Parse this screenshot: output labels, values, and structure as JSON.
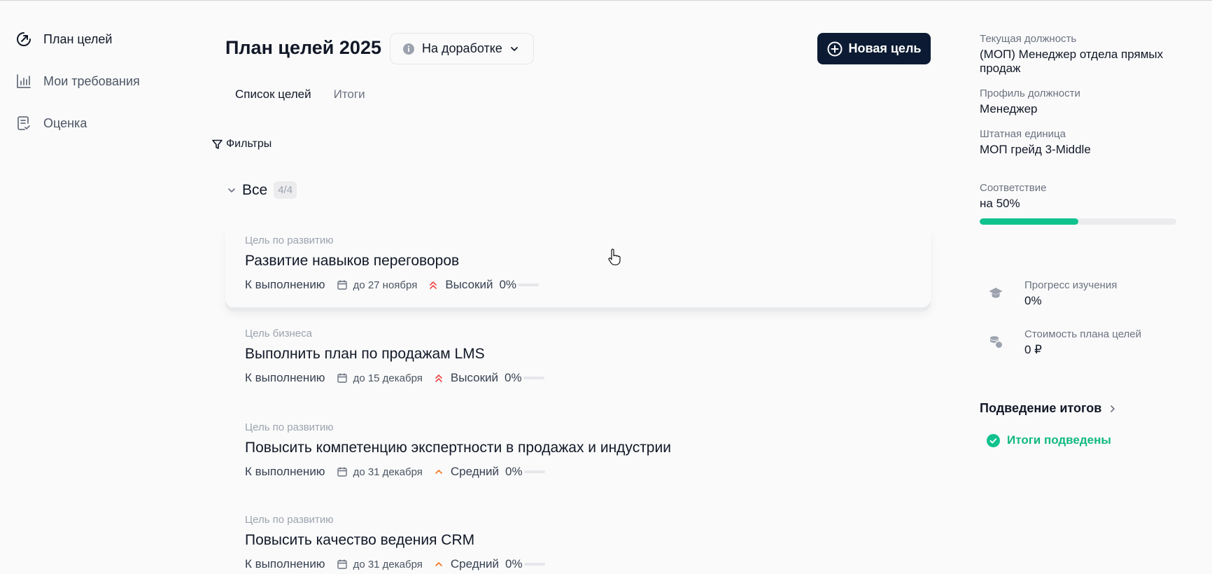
{
  "sidebar": {
    "items": [
      {
        "label": "План целей",
        "icon": "target-arrow-icon",
        "active": true
      },
      {
        "label": "Мои требования",
        "icon": "chart-bars-icon",
        "active": false
      },
      {
        "label": "Оценка",
        "icon": "document-check-icon",
        "active": false
      }
    ]
  },
  "header": {
    "title": "План целей 2025",
    "status_label": "На доработке",
    "new_goal_label": "Новая цель"
  },
  "tabs": [
    {
      "label": "Список целей",
      "active": true
    },
    {
      "label": "Итоги",
      "active": false
    }
  ],
  "filters": {
    "label": "Фильтры"
  },
  "group": {
    "label": "Все",
    "badge": "4/4"
  },
  "goals": [
    {
      "type": "Цель по развитию",
      "title": "Развитие навыков переговоров",
      "status": "К выполнению",
      "deadline": "до 27 ноября",
      "priority": "Высокий",
      "priority_level": "high",
      "progress": "0%",
      "progress_fraction": 0
    },
    {
      "type": "Цель бизнеса",
      "title": "Выполнить план по продажам LMS",
      "status": "К выполнению",
      "deadline": "до 15 декабря",
      "priority": "Высокий",
      "priority_level": "high",
      "progress": "0%",
      "progress_fraction": 0
    },
    {
      "type": "Цель по развитию",
      "title": "Повысить компетенцию экспертности в продажах и индустрии",
      "status": "К выполнению",
      "deadline": "до 31 декабря",
      "priority": "Средний",
      "priority_level": "medium",
      "progress": "0%",
      "progress_fraction": 0
    },
    {
      "type": "Цель по развитию",
      "title": "Повысить качество ведения CRM",
      "status": "К выполнению",
      "deadline": "до 31 декабря",
      "priority": "Средний",
      "priority_level": "medium",
      "progress": "0%",
      "progress_fraction": 0
    }
  ],
  "profile": {
    "position_label": "Текущая должность",
    "position_value": "(МОП) Менеджер отдела прямых продаж",
    "profile_label": "Профиль должности",
    "profile_value": "Менеджер",
    "unit_label": "Штатная единица",
    "unit_value": "МОП грейд 3-Middle",
    "match_label": "Соответствие",
    "match_value": "на 50%",
    "match_fraction": 0.5
  },
  "stats": {
    "learning_label": "Прогресс изучения",
    "learning_value": "0%",
    "cost_label": "Стоимость плана целей",
    "cost_value": "0 ₽"
  },
  "summary": {
    "link_label": "Подведение итогов",
    "status_label": "Итоги подведены"
  },
  "colors": {
    "accent": "#0c1b33",
    "success": "#10c28e",
    "priority_high": "#ef4444",
    "priority_medium": "#f97316"
  }
}
